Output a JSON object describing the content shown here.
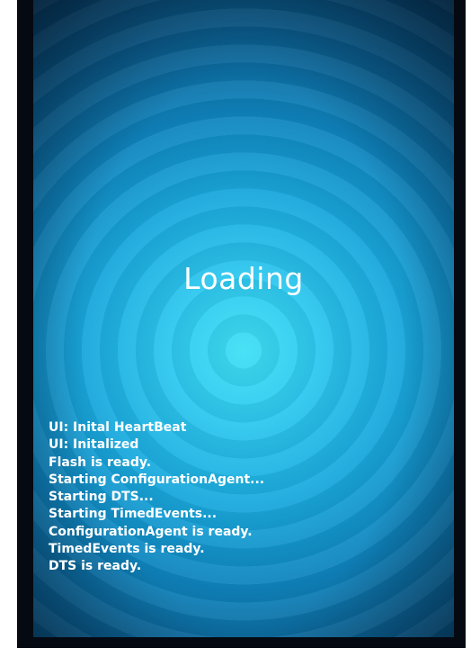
{
  "screen": {
    "title": "Loading",
    "log_lines": [
      "UI: Inital HeartBeat",
      "UI: Initalized",
      "Flash is ready.",
      "Starting ConfigurationAgent...",
      "Starting DTS...",
      "Starting TimedEvents...",
      "ConfigurationAgent is ready.",
      "TimedEvents is ready.",
      "DTS is ready."
    ]
  },
  "colors": {
    "center_glow": "#3fe0f5",
    "edge": "#073b5e",
    "bezel": "#050a12",
    "text": "#ffffff"
  }
}
